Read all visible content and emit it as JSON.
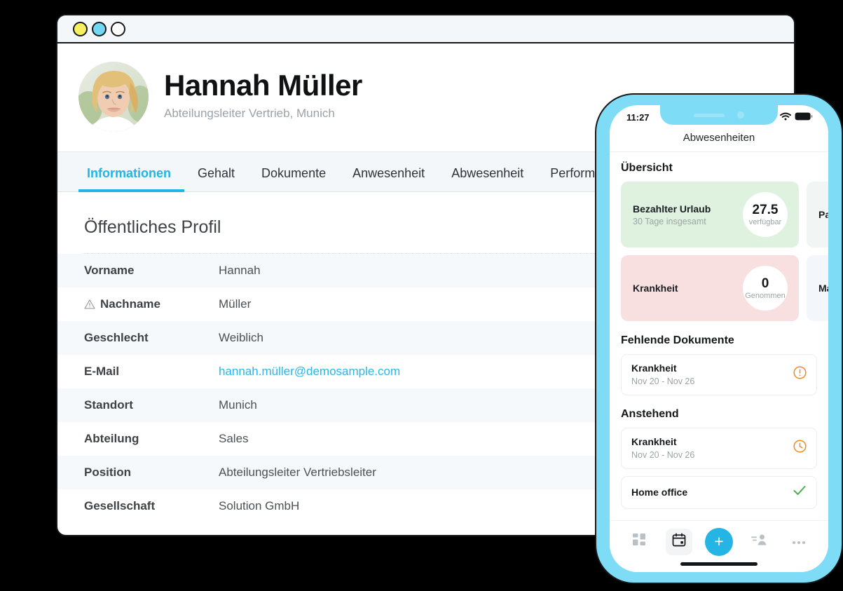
{
  "window": {
    "dots": [
      {
        "name": "close-dot",
        "color": "#f6ef5e"
      },
      {
        "name": "minimize-dot",
        "color": "#72d7f2"
      },
      {
        "name": "maximize-dot",
        "color": "#ffffff"
      }
    ]
  },
  "profile": {
    "name": "Hannah Müller",
    "subtitle": "Abteilungsleiter Vertrieb, Munich",
    "avatar_alt": "Hannah Müller portrait"
  },
  "tabs": [
    {
      "label": "Informationen",
      "active": true
    },
    {
      "label": "Gehalt",
      "active": false
    },
    {
      "label": "Dokumente",
      "active": false
    },
    {
      "label": "Anwesenheit",
      "active": false
    },
    {
      "label": "Abwesenheit",
      "active": false
    },
    {
      "label": "Performance",
      "active": false
    }
  ],
  "section": {
    "title": "Öffentliches Profil"
  },
  "fields": [
    {
      "label": "Vorname",
      "value": "Hannah",
      "warning": false,
      "link": false
    },
    {
      "label": "Nachname",
      "value": "Müller",
      "warning": true,
      "link": false
    },
    {
      "label": "Geschlecht",
      "value": "Weiblich",
      "warning": false,
      "link": false
    },
    {
      "label": "E-Mail",
      "value": "hannah.müller@demosample.com",
      "warning": false,
      "link": true
    },
    {
      "label": "Standort",
      "value": "Munich",
      "warning": false,
      "link": false
    },
    {
      "label": "Abteilung",
      "value": "Sales",
      "warning": false,
      "link": false
    },
    {
      "label": "Position",
      "value": "Abteilungsleiter Vertriebsleiter",
      "warning": false,
      "link": false
    },
    {
      "label": "Gesellschaft",
      "value": "Solution GmbH",
      "warning": false,
      "link": false
    }
  ],
  "phone": {
    "status": {
      "time": "11:27",
      "signal_icon": "signal-dots-icon",
      "wifi_icon": "wifi-icon",
      "battery_icon": "battery-icon"
    },
    "nav_title": "Abwesenheiten",
    "overview_heading": "Übersicht",
    "stat_cards": [
      {
        "name": "Bezahlter Urlaub",
        "sub": "30 Tage insgesamt",
        "number": "27.5",
        "unit": "verfügbar",
        "tone": "green"
      },
      {
        "name": "Pa",
        "sub": "",
        "number": "",
        "unit": "",
        "tone": "grey"
      },
      {
        "name": "Krankheit",
        "sub": "",
        "number": "0",
        "unit": "Genommen",
        "tone": "red"
      },
      {
        "name": "Ma",
        "sub": "",
        "number": "",
        "unit": "",
        "tone": "grey2"
      }
    ],
    "missing_docs_heading": "Fehlende Dokumente",
    "missing_docs": [
      {
        "title": "Krankheit",
        "dates": "Nov 20 - Nov 26",
        "icon": "alert-circle-icon"
      }
    ],
    "pending_heading": "Anstehend",
    "pending": [
      {
        "title": "Krankheit",
        "dates": "Nov 20 - Nov 26",
        "icon": "clock-icon"
      },
      {
        "title": "Home office",
        "dates": "",
        "icon": "check-icon"
      }
    ],
    "nav_items": [
      {
        "name": "dashboard-icon",
        "selected": false
      },
      {
        "name": "calendar-icon",
        "selected": true
      },
      {
        "name": "add-icon",
        "selected": false
      },
      {
        "name": "people-icon",
        "selected": false
      },
      {
        "name": "more-icon",
        "selected": false
      }
    ],
    "fab_label": "+"
  },
  "colors": {
    "accent": "#22b4e3",
    "link": "#29b6e8",
    "phone_frame": "#7fdcf7",
    "green_card": "#dff2e0",
    "red_card": "#f8e0e0",
    "warn_orange": "#f08a1e",
    "check_green": "#4caf50"
  }
}
